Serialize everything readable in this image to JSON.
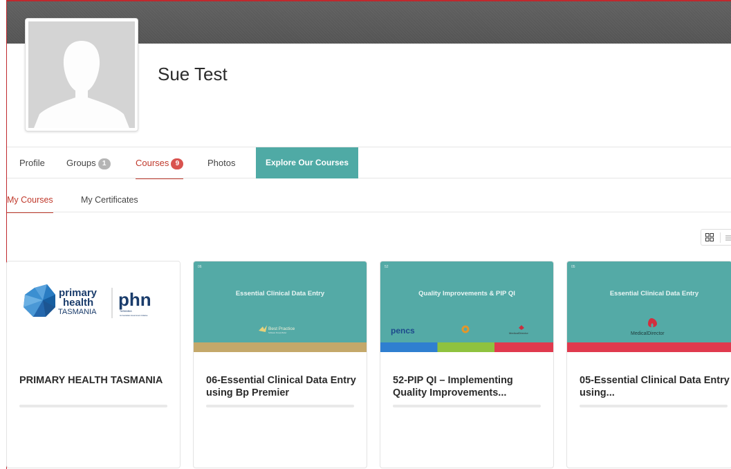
{
  "profile": {
    "name": "Sue Test"
  },
  "tabs": [
    {
      "label": "Profile"
    },
    {
      "label": "Groups",
      "badge": "1"
    },
    {
      "label": "Courses",
      "badge": "9"
    },
    {
      "label": "Photos"
    }
  ],
  "explore_button": "Explore Our Courses",
  "subtabs": [
    {
      "label": "My Courses"
    },
    {
      "label": "My Certificates"
    }
  ],
  "colors": {
    "accent": "#c0392b",
    "teal": "#4faaa5",
    "badge_grey": "#b5b5b5",
    "badge_red": "#d9534f"
  },
  "courses": [
    {
      "title": "PRIMARY HEALTH TASMANIA",
      "logo_text_1": "primary",
      "logo_text_2": "health",
      "logo_text_3": "TASMANIA",
      "logo_text_4": "phn",
      "logo_text_5": "TASMANIA",
      "logo_text_6": "An Australian Government Initiative"
    },
    {
      "title": "06-Essential Clinical Data Entry using Bp Premier",
      "thumb_heading": "Essential Clinical Data Entry",
      "thumb_number": "06",
      "thumb_brand": "Best Practice",
      "thumb_brand_sub": "Software Simply Better"
    },
    {
      "title": "52-PIP QI – Implementing Quality Improvements...",
      "thumb_heading": "Quality Improvements & PIP QI",
      "thumb_number": "52",
      "thumb_brand_1": "pencs",
      "thumb_brand_2": "MedicalDirector"
    },
    {
      "title": "05-Essential Clinical Data Entry using...",
      "thumb_heading": "Essential Clinical Data Entry",
      "thumb_number": "05",
      "thumb_brand": "MedicalDirector"
    }
  ]
}
